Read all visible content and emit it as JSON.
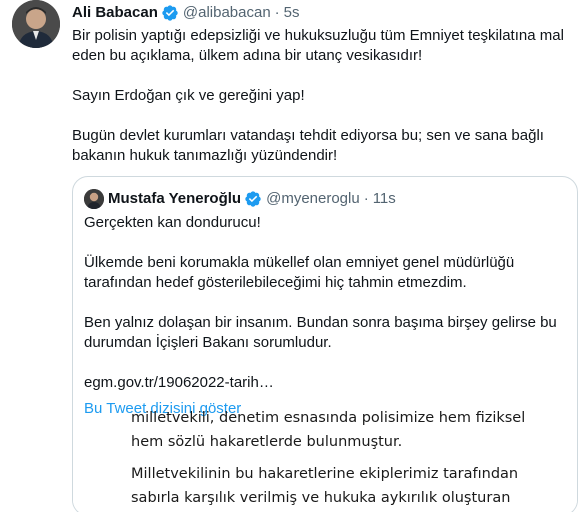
{
  "tweet": {
    "author_name": "Ali Babacan",
    "author_handle": "@alibabacan",
    "separator": "·",
    "time": "5s",
    "paragraphs": [
      "Bir polisin yaptığı edepsizliği ve hukuksuzluğu tüm Emniyet teşkilatına mal eden bu açıklama, ülkem adına bir utanç vesikasıdır!",
      "Sayın Erdoğan çık ve gereğini yap!",
      "Bugün devlet kurumları vatandaşı tehdit ediyorsa bu; sen ve sana bağlı bakanın hukuk tanımazlığı yüzündendir!"
    ]
  },
  "quoted_tweet": {
    "author_name": "Mustafa Yeneroğlu",
    "author_handle": "@myeneroglu",
    "separator": "·",
    "time": "11s",
    "paragraphs": [
      "Gerçekten kan dondurucu!",
      "Ülkemde beni korumakla mükellef olan emniyet genel müdürlüğü tarafından hedef gösterilebileceğimi hiç tahmin etmezdim.",
      "Ben yalnız dolaşan bir insanım. Bundan sonra başıma birşey gelirse bu durumdan İçişleri Bakanı sorumludur."
    ],
    "link_text": "egm.gov.tr/19062022-tarih…",
    "show_thread_label": "Bu Tweet dizisini göster"
  },
  "document_image": {
    "lines": [
      "milletvekili, denetim esnasında polisimize hem fiziksel",
      "hem sözlü hakaretlerde bulunmuştur.",
      "Milletvekilinin bu hakaretlerine ekiplerimiz tarafından",
      "sabırla karşılık verilmiş ve hukuka aykırılık oluşturan"
    ]
  },
  "colors": {
    "verified_badge": "#1d9bf0",
    "link_blue": "#1d9bf0",
    "muted_text": "#536471",
    "border": "#cfd9de"
  },
  "icons": {
    "verified": "verified-badge-icon"
  }
}
